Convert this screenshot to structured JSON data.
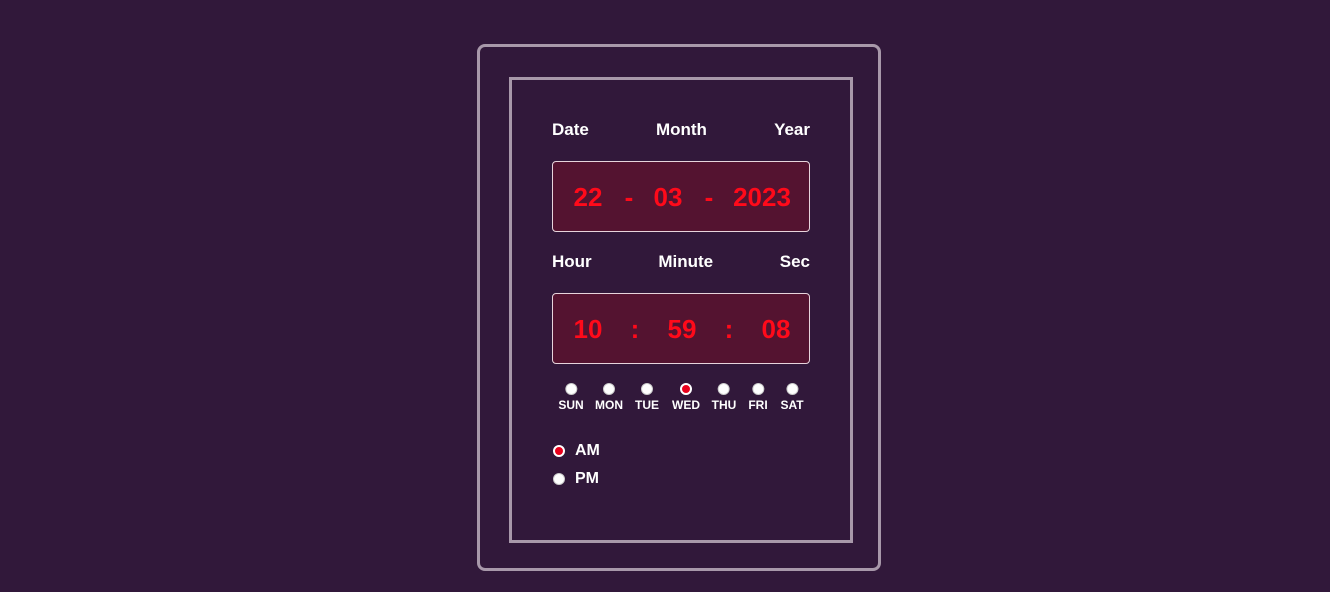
{
  "date_labels": {
    "date": "Date",
    "month": "Month",
    "year": "Year"
  },
  "date_display": {
    "day": "22",
    "sep1": "-",
    "month": "03",
    "sep2": "-",
    "year": "2023"
  },
  "time_labels": {
    "hour": "Hour",
    "minute": "Minute",
    "sec": "Sec"
  },
  "time_display": {
    "hour": "10",
    "sep1": ":",
    "minute": "59",
    "sep2": ":",
    "sec": "08"
  },
  "weekdays": [
    {
      "label": "SUN",
      "checked": false
    },
    {
      "label": "MON",
      "checked": false
    },
    {
      "label": "TUE",
      "checked": false
    },
    {
      "label": "WED",
      "checked": true
    },
    {
      "label": "THU",
      "checked": false
    },
    {
      "label": "FRI",
      "checked": false
    },
    {
      "label": "SAT",
      "checked": false
    }
  ],
  "meridiem": [
    {
      "label": "AM",
      "checked": true
    },
    {
      "label": "PM",
      "checked": false
    }
  ],
  "colors": {
    "background": "#31183a",
    "border": "#a898aa",
    "display_bg": "#541330",
    "digit": "#ff0a1a",
    "accent": "#e8001c"
  }
}
